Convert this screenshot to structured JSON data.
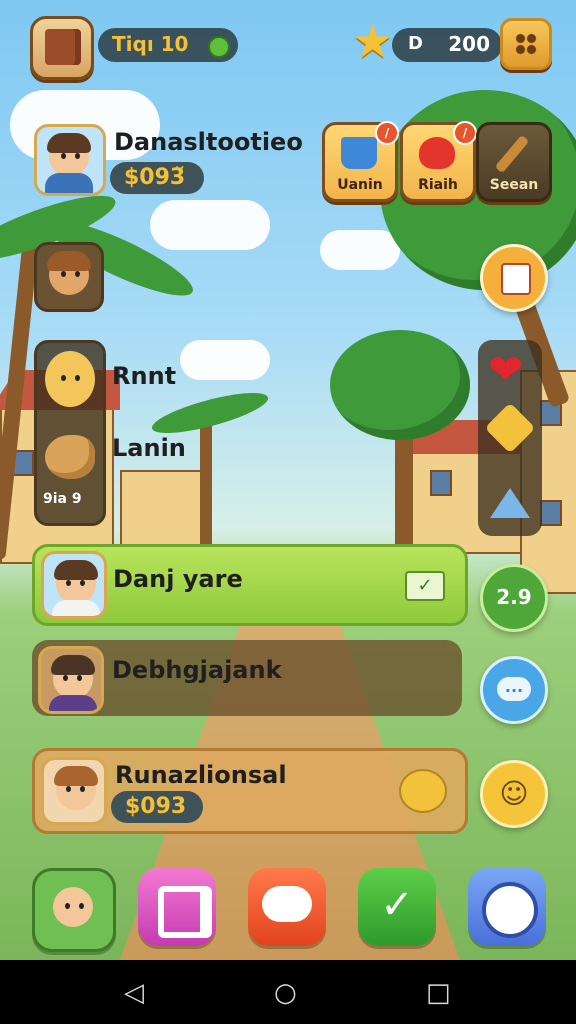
{
  "header": {
    "level_text": "Tiqı 10",
    "star_value_prefix": "D",
    "star_value": "200"
  },
  "player": {
    "name": "Danasltootieo",
    "coins": "$093̆"
  },
  "tools": [
    {
      "label": "Uanin"
    },
    {
      "label": "Riaih"
    },
    {
      "label": "Seean"
    }
  ],
  "side_list": {
    "item1_label": "Rnnt",
    "item2_label": "Lanin",
    "item2_count": "9ia 9"
  },
  "rows": [
    {
      "name": "Danj yare"
    },
    {
      "name": "Debhgjajank"
    },
    {
      "name": "Runazlionsal",
      "coins": "$093"
    }
  ],
  "side_circle": {
    "text": "2.9"
  },
  "colors": {
    "active_row": "#a3d94a",
    "row_dark": "rgba(110,80,45,0.78)",
    "coin_text": "#f5c033"
  }
}
